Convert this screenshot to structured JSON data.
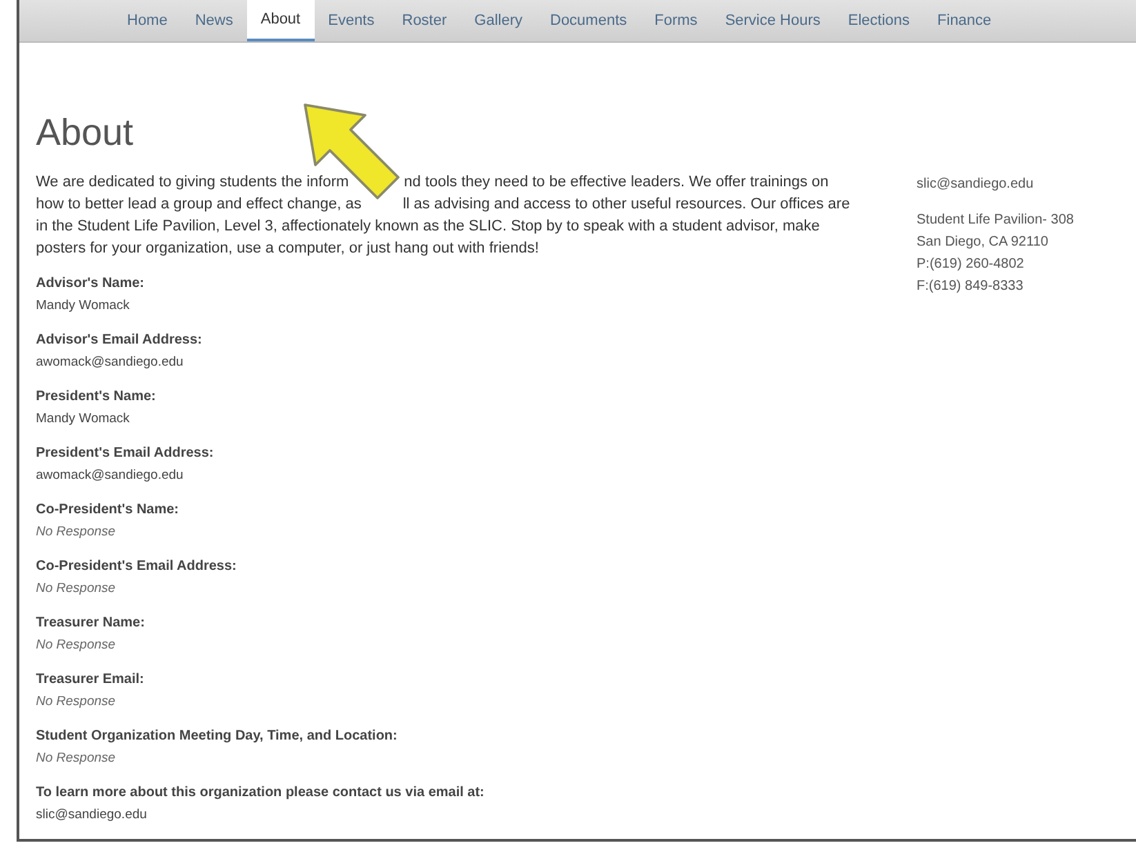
{
  "nav": [
    {
      "label": "Home",
      "selected": false
    },
    {
      "label": "News",
      "selected": false
    },
    {
      "label": "About",
      "selected": true
    },
    {
      "label": "Events",
      "selected": false
    },
    {
      "label": "Roster",
      "selected": false
    },
    {
      "label": "Gallery",
      "selected": false
    },
    {
      "label": "Documents",
      "selected": false
    },
    {
      "label": "Forms",
      "selected": false
    },
    {
      "label": "Service Hours",
      "selected": false
    },
    {
      "label": "Elections",
      "selected": false
    },
    {
      "label": "Finance",
      "selected": false
    }
  ],
  "title": "About",
  "description_lines": [
    [
      "We are dedicated to giving students the inform",
      "nd tools they need to be effective leaders. We offer trainings on"
    ],
    [
      "how to better lead a group and effect change, as",
      "ll as advising and access to other useful resources. Our offices are"
    ],
    [
      "in the Student Life Pavilion, Level 3, affectionately known as the SLIC. Stop by to speak with a student advisor, make"
    ],
    [
      "posters for your organization, use a computer, or just hang out with friends!"
    ]
  ],
  "fields": [
    {
      "label": "Advisor's Name:",
      "value": "Mandy Womack",
      "empty": false
    },
    {
      "label": "Advisor's Email Address:",
      "value": "awomack@sandiego.edu",
      "empty": false
    },
    {
      "label": "President's Name:",
      "value": "Mandy Womack",
      "empty": false
    },
    {
      "label": "President's Email Address:",
      "value": "awomack@sandiego.edu",
      "empty": false
    },
    {
      "label": "Co-President's Name:",
      "value": "No Response",
      "empty": true
    },
    {
      "label": "Co-President's Email Address:",
      "value": "No Response",
      "empty": true
    },
    {
      "label": "Treasurer Name:",
      "value": "No Response",
      "empty": true
    },
    {
      "label": "Treasurer Email:",
      "value": "No Response",
      "empty": true
    },
    {
      "label": "Student Organization Meeting Day, Time, and Location:",
      "value": "No Response",
      "empty": true
    },
    {
      "label": "To learn more about this organization please contact us via email at:",
      "value": "slic@sandiego.edu",
      "empty": false
    }
  ],
  "contact": {
    "email": "slic@sandiego.edu",
    "address_lines": [
      "Student Life Pavilion- 308",
      "San Diego, CA 92110",
      "P:(619) 260-4802",
      "F:(619) 849-8333"
    ]
  }
}
